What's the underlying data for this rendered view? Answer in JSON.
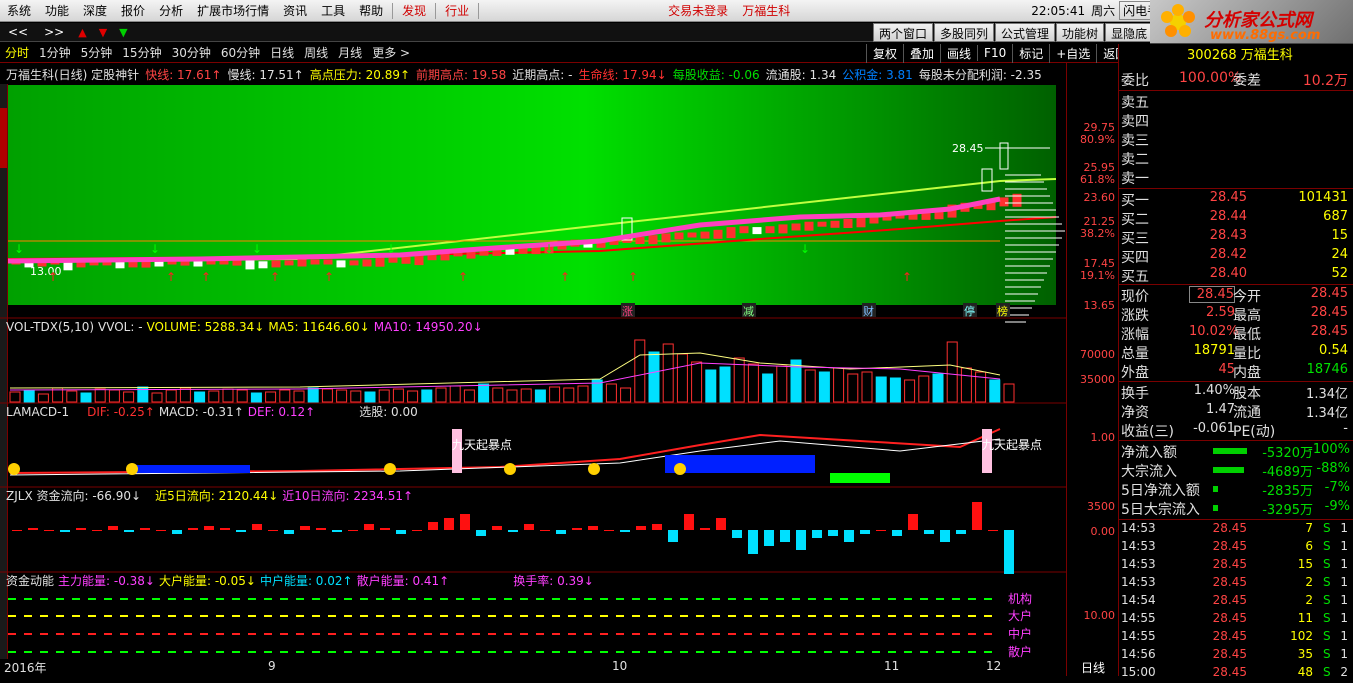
{
  "menubar": {
    "items": [
      "系统",
      "功能",
      "深度",
      "报价",
      "分析",
      "扩展市场行情",
      "资讯",
      "工具",
      "帮助"
    ],
    "hl_items": [
      "发现",
      "行业"
    ],
    "status": "交易未登录",
    "stock_name": "万福生科",
    "time": "22:05:41",
    "weekday": "周六",
    "flash": "闪电手"
  },
  "toolbar": {
    "nav": [
      "<<",
      ">>"
    ],
    "right_tabs": [
      "两个窗口",
      "多股同列",
      "公式管理",
      "功能树",
      "显隐底"
    ]
  },
  "logo": {
    "name": "分析家公式网",
    "url": "www.88gs.com"
  },
  "periods": [
    "分时",
    "1分钟",
    "5分钟",
    "15分钟",
    "30分钟",
    "60分钟",
    "日线",
    "周线",
    "月线",
    "更多 >"
  ],
  "active_period": "分时",
  "tool_buttons": [
    "复权",
    "叠加",
    "画线",
    "F10",
    "标记",
    "+自选",
    "返回"
  ],
  "main_title": {
    "name": "万福生科(日线) 定股神针",
    "fast": "快线: 17.61↑",
    "slow": "慢线: 17.51↑",
    "high_press": "高点压力: 20.89↑",
    "prev_high": "前期高点: 19.58",
    "recent_high": "近期高点: -",
    "life": "生命线: 17.94↓",
    "eps": "每股收益: -0.06",
    "float": "流通股: 1.34",
    "reserve": "公积金: 3.81",
    "undist": "每股未分配利润: -2.35"
  },
  "main_axis": [
    {
      "v": "29.75",
      "c": "#ff4444"
    },
    {
      "v": "80.9%",
      "c": "#ff4444"
    },
    {
      "v": "25.95",
      "c": "#ff4444"
    },
    {
      "v": "61.8%",
      "c": "#ff4444"
    },
    {
      "v": "23.60",
      "c": "#ff4444"
    },
    {
      "v": "21.25",
      "c": "#ff4444"
    },
    {
      "v": "38.2%",
      "c": "#ff4444"
    },
    {
      "v": "17.45",
      "c": "#ff4444"
    },
    {
      "v": "19.1%",
      "c": "#ff4444"
    },
    {
      "v": "13.65",
      "c": "#ff4444"
    }
  ],
  "price_labels": {
    "last": "28.45",
    "low": "13.00"
  },
  "event_tags": [
    "涨",
    "减",
    "财",
    "停",
    "榜"
  ],
  "vol_title": {
    "name": "VOL-TDX(5,10)",
    "vvol": "VVOL: -",
    "volume": "VOLUME: 5288.34↓",
    "ma5": "MA5: 11646.60↓",
    "ma10": "MA10: 14950.20↓"
  },
  "vol_axis": [
    "70000",
    "35000"
  ],
  "macd_title": {
    "name": "LAMACD-1",
    "dif": "DIF: -0.25↑",
    "macd": "MACD: -0.31↑",
    "def": "DEF: 0.12↑",
    "sel": "选股: 0.00"
  },
  "macd_axis": [
    "1.00"
  ],
  "macd_note": "九天起暴点",
  "zjlx_title": {
    "name": "ZJLX 资金流向: -66.90↓",
    "d5": "近5日流向: 2120.44↓",
    "d10": "近10日流向: 2234.51↑"
  },
  "zjlx_axis": [
    "3500",
    "0.00"
  ],
  "fund_title": {
    "name": "资金动能",
    "main": "主力能量: -0.38↓",
    "big": "大户能量: -0.05↓",
    "mid": "中户能量: 0.02↑",
    "ret": "散户能量: 0.41↑",
    "turn": "换手率: 0.39↓"
  },
  "fund_axis": [
    "10.00"
  ],
  "fund_labels": [
    "机构",
    "大户",
    "中户",
    "散户"
  ],
  "dates": [
    "2016年",
    "9",
    "10",
    "11",
    "12"
  ],
  "period_label": "日线",
  "quote": {
    "code": "300268 万福生科",
    "wb_label": "委比",
    "wb": "100.00%",
    "wc_label": "委差",
    "wc": "10.2万",
    "asks": [
      "卖五",
      "卖四",
      "卖三",
      "卖二",
      "卖一"
    ],
    "bids": [
      {
        "l": "买一",
        "p": "28.45",
        "q": "101431"
      },
      {
        "l": "买二",
        "p": "28.44",
        "q": "687"
      },
      {
        "l": "买三",
        "p": "28.43",
        "q": "15"
      },
      {
        "l": "买四",
        "p": "28.42",
        "q": "24"
      },
      {
        "l": "买五",
        "p": "28.40",
        "q": "52"
      }
    ],
    "stats": [
      [
        "现价",
        "28.45",
        "今开",
        "28.45"
      ],
      [
        "涨跌",
        "2.59",
        "最高",
        "28.45"
      ],
      [
        "涨幅",
        "10.02%",
        "最低",
        "28.45"
      ],
      [
        "总量",
        "18791",
        "量比",
        "0.54"
      ],
      [
        "外盘",
        "45",
        "内盘",
        "18746"
      ]
    ],
    "stats2": [
      [
        "换手",
        "1.40%",
        "股本",
        "1.34亿"
      ],
      [
        "净资",
        "1.47",
        "流通",
        "1.34亿"
      ],
      [
        "收益(三)",
        "-0.061",
        "PE(动)",
        "-"
      ]
    ],
    "flows": [
      {
        "l": "净流入额",
        "v": "-5320万",
        "pc": "-100%",
        "bar": 0.95
      },
      {
        "l": "大宗流入",
        "v": "-4689万",
        "pc": "-88%",
        "bar": 0.85
      },
      {
        "l": "5日净流入额",
        "v": "-2835万",
        "pc": "-7%",
        "bar": 0.15
      },
      {
        "l": "5日大宗流入",
        "v": "-3295万",
        "pc": "-9%",
        "bar": 0.15
      }
    ],
    "ticks": [
      {
        "t": "14:53",
        "p": "28.45",
        "v": "7",
        "s": "S",
        "n": "1"
      },
      {
        "t": "14:53",
        "p": "28.45",
        "v": "6",
        "s": "S",
        "n": "1"
      },
      {
        "t": "14:53",
        "p": "28.45",
        "v": "15",
        "s": "S",
        "n": "1"
      },
      {
        "t": "14:53",
        "p": "28.45",
        "v": "2",
        "s": "S",
        "n": "1"
      },
      {
        "t": "14:54",
        "p": "28.45",
        "v": "2",
        "s": "S",
        "n": "1"
      },
      {
        "t": "14:55",
        "p": "28.45",
        "v": "11",
        "s": "S",
        "n": "1"
      },
      {
        "t": "14:55",
        "p": "28.45",
        "v": "102",
        "s": "S",
        "n": "1"
      },
      {
        "t": "14:56",
        "p": "28.45",
        "v": "35",
        "s": "S",
        "n": "1"
      },
      {
        "t": "15:00",
        "p": "28.45",
        "v": "48",
        "s": "S",
        "n": "2"
      }
    ]
  },
  "colors": {
    "up": "#ff3030",
    "down": "#00e0ff",
    "grid": "#7a0000",
    "green_bg": "#00b000"
  }
}
